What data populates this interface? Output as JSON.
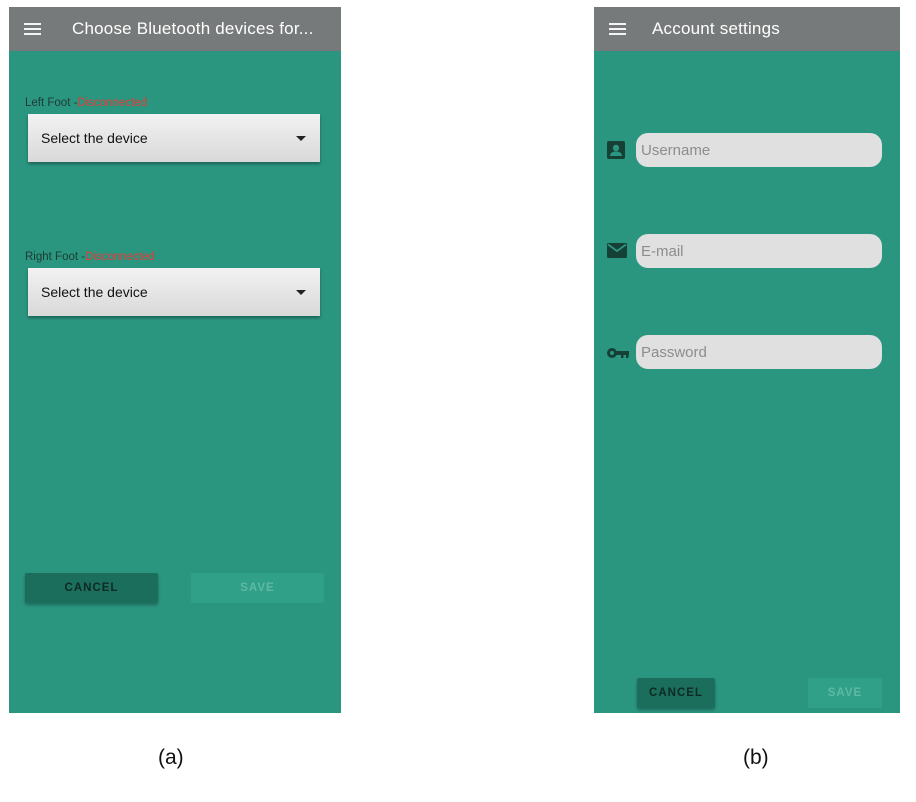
{
  "screen_a": {
    "title": "Choose Bluetooth devices for...",
    "left_foot": {
      "label": "Left Foot -",
      "status": "Disconnected",
      "dropdown": "Select the device"
    },
    "right_foot": {
      "label": "Right Foot -",
      "status": "Disconnected",
      "dropdown": "Select the device"
    },
    "cancel_label": "CANCEL",
    "save_label": "SAVE",
    "caption": "(a)"
  },
  "screen_b": {
    "title": "Account settings",
    "username": {
      "placeholder": "Username",
      "icon": "account-box-icon"
    },
    "email": {
      "placeholder": "E-mail",
      "icon": "mail-icon"
    },
    "password": {
      "placeholder": "Password",
      "icon": "key-icon"
    },
    "cancel_label": "CANCEL",
    "save_label": "SAVE",
    "caption": "(b)"
  },
  "colors": {
    "screen_bg": "#2a9680",
    "appbar": "#777a7a",
    "status_error": "#e53935",
    "button_cancel": "#1b6e5c"
  }
}
